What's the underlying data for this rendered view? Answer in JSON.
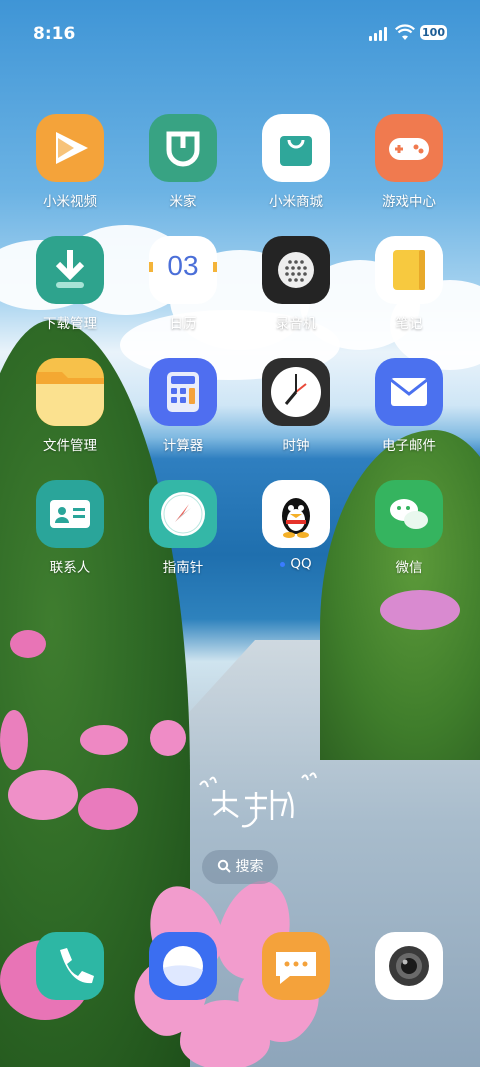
{
  "status": {
    "time": "8:16",
    "battery": "100"
  },
  "rows": [
    [
      {
        "name": "小米视频",
        "bg": "#f4a33a"
      },
      {
        "name": "米家",
        "bg": "#38a383"
      },
      {
        "name": "小米商城",
        "bg": "#ffffff"
      },
      {
        "name": "游戏中心",
        "bg": "#f07a4f"
      }
    ],
    [
      {
        "name": "下载管理",
        "bg": "#2ea38d"
      },
      {
        "name": "日历",
        "bg": "#ffffff",
        "date": "03"
      },
      {
        "name": "录音机",
        "bg": "#242424"
      },
      {
        "name": "笔记",
        "bg": "#ffffff"
      }
    ],
    [
      {
        "name": "文件管理",
        "bg": "#f7c14a"
      },
      {
        "name": "计算器",
        "bg": "#4f6ef0"
      },
      {
        "name": "时钟",
        "bg": "#2e2e2e"
      },
      {
        "name": "电子邮件",
        "bg": "#4b71ef"
      }
    ],
    [
      {
        "name": "联系人",
        "bg": "#2aa59a"
      },
      {
        "name": "指南针",
        "bg": "#34b7a7"
      },
      {
        "name": "QQ",
        "bg": "#ffffff"
      },
      {
        "name": "微信",
        "bg": "#35b45f"
      }
    ]
  ],
  "search": {
    "label": "搜索"
  },
  "dock": [
    {
      "name": "phone",
      "bg": "#2db7a4"
    },
    {
      "name": "browser",
      "bg": "#3b6ef1"
    },
    {
      "name": "messages",
      "bg": "#f4a23b"
    },
    {
      "name": "camera",
      "bg": "#ffffff"
    }
  ]
}
